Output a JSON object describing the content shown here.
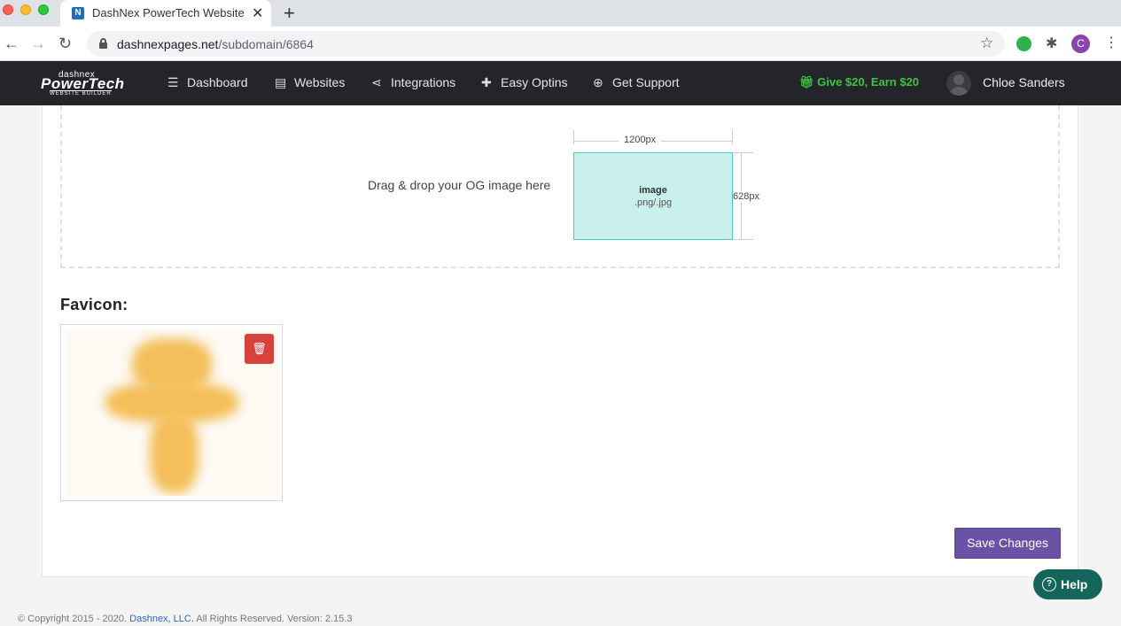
{
  "browser": {
    "tab_title": "DashNex PowerTech Website B",
    "tab_favicon": "N",
    "url_domain": "dashnexpages.net",
    "url_path": "/subdomain/6864",
    "profile_initial": "C",
    "icons": [
      "back-arrow-icon",
      "forward-arrow-icon",
      "reload-icon",
      "lock-icon",
      "star-icon",
      "extension-icon",
      "puzzle-icon",
      "kebab-menu-icon"
    ]
  },
  "app_nav": {
    "logo_top": "dashnex",
    "logo_main": "PowerTech",
    "logo_sub": "WEBSITE BUILDER",
    "items": [
      {
        "label": "Dashboard",
        "icon": "list-icon"
      },
      {
        "label": "Websites",
        "icon": "book-icon"
      },
      {
        "label": "Integrations",
        "icon": "share-icon"
      },
      {
        "label": "Easy Optins",
        "icon": "puzzle-icon"
      },
      {
        "label": "Get Support",
        "icon": "lifebuoy-icon"
      }
    ],
    "promo": "Give $20, Earn $20",
    "user_name": "Chloe Sanders"
  },
  "og_image": {
    "dropzone_text": "Drag & drop your OG image here",
    "width_label": "1200px",
    "height_label": "628px",
    "box_title": "image",
    "box_subtitle": ".png/.jpg"
  },
  "favicon": {
    "title": "Favicon:",
    "delete_icon": "trash-icon"
  },
  "actions": {
    "save_label": "Save Changes"
  },
  "help": {
    "label": "Help"
  },
  "footer": {
    "prefix": "© Copyright 2015 - 2020.",
    "company": "Dashnex, LLC.",
    "suffix": "All Rights Reserved. Version: 2.15.3"
  },
  "colors": {
    "nav_bg": "#23252b",
    "promo": "#3ec33e",
    "save_button": "#6a52a5",
    "delete_button": "#d9413c",
    "og_box": "#c9f0ec",
    "help_button": "#14665a"
  }
}
